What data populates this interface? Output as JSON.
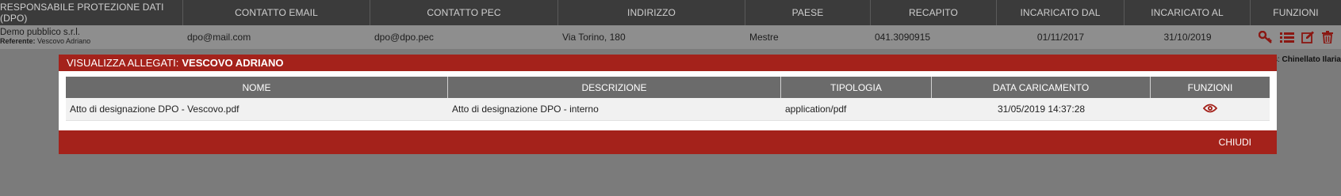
{
  "table": {
    "columns": [
      "RESPONSABILE PROTEZIONE DATI (DPO)",
      "CONTATTO EMAIL",
      "CONTATTO PEC",
      "INDIRIZZO",
      "PAESE",
      "RECAPITO",
      "INCARICATO DAL",
      "INCARICATO AL",
      "FUNZIONI"
    ],
    "row": {
      "company": "Demo pubblico s.r.l.",
      "referent_label": "Referente:",
      "referent": "Vescovo Adriano",
      "email": "dpo@mail.com",
      "pec": "dpo@dpo.pec",
      "address": "Via Torino, 180",
      "town": "Mestre",
      "phone": "041.3090915",
      "from": "01/11/2017",
      "to": "31/10/2019"
    },
    "icons": [
      "key-icon",
      "list-icon",
      "edit-icon",
      "trash-icon"
    ]
  },
  "side_note": {
    "prefix": "ds:",
    "name": "Chinellato Ilaria"
  },
  "modal": {
    "title_label": "VISUALIZZA ALLEGATI:",
    "title_name": "VESCOVO ADRIANO",
    "columns": [
      "NOME",
      "DESCRIZIONE",
      "TIPOLOGIA",
      "DATA CARICAMENTO",
      "FUNZIONI"
    ],
    "rows": [
      {
        "name": "Atto di designazione DPO - Vescovo.pdf",
        "description": "Atto di designazione DPO - interno",
        "type": "application/pdf",
        "uploaded": "31/05/2019 14:37:28",
        "icon": "eye-icon"
      }
    ],
    "close_label": "CHIUDI"
  },
  "colors": {
    "accent_red": "#a4221b",
    "header_dark": "#3b3b3b",
    "overlay": "#7b7b7b"
  }
}
